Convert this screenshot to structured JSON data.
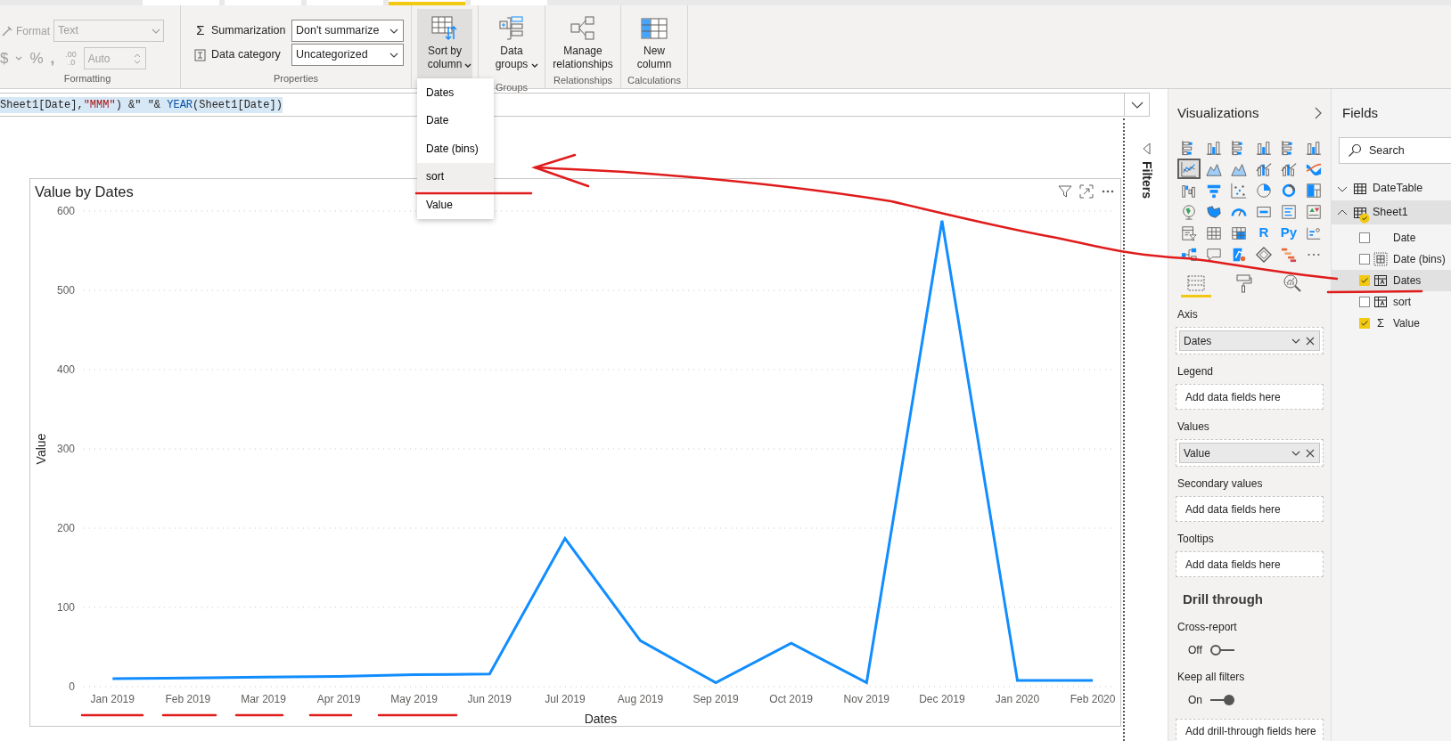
{
  "ribbon_tabs": [
    {
      "selected": false
    },
    {
      "selected": false
    },
    {
      "selected": false
    },
    {
      "selected": true
    },
    {
      "selected": false
    }
  ],
  "formatting": {
    "disabled": true,
    "format_label": "Format",
    "format_value": "Text",
    "currency": "$",
    "percent": "%",
    "comma": ",",
    "decimals_top": ".00",
    "decimals_bottom": ".0",
    "spin_value": "Auto",
    "label": "Formatting"
  },
  "properties": {
    "summarization": {
      "symbol": "Σ",
      "label": "Summarization",
      "value": "Don't summarize"
    },
    "data_category": {
      "label": "Data category",
      "value": "Uncategorized"
    },
    "label": "Properties"
  },
  "ribbon_buttons": [
    {
      "kind": "sort",
      "label": "Sort by column",
      "caret": true,
      "pressed": true
    },
    {
      "kind": "groups",
      "label": "Data groups",
      "caret": true,
      "pressed": false,
      "group": "Groups"
    },
    {
      "kind": "relationships",
      "label": "Manage relationships",
      "caret": false,
      "pressed": false,
      "group": "Relationships"
    },
    {
      "kind": "column",
      "label": "New column",
      "caret": false,
      "pressed": false,
      "group": "Calculations"
    }
  ],
  "sort_menu": [
    {
      "label": "Dates",
      "highlighted": false
    },
    {
      "label": "Date",
      "highlighted": false
    },
    {
      "label": "Date (bins)",
      "highlighted": false
    },
    {
      "label": "sort",
      "highlighted": true
    },
    {
      "label": "Value",
      "highlighted": false
    }
  ],
  "formula": [
    {
      "text": "Sheet1[Date],",
      "kind": "plain"
    },
    {
      "text": "\"MMM\"",
      "kind": "string"
    },
    {
      "text": ") &\" \"& ",
      "kind": "plain"
    },
    {
      "text": "YEAR",
      "kind": "function"
    },
    {
      "text": "(Sheet1[Date])",
      "kind": "plain"
    }
  ],
  "visual": {
    "chart_data": {
      "type": "line",
      "title": "Value by Dates",
      "xlabel": "Dates",
      "ylabel": "Value",
      "categories": [
        "Jan 2019",
        "Feb 2019",
        "Mar 2019",
        "Apr 2019",
        "May 2019",
        "Jun 2019",
        "Jul 2019",
        "Aug 2019",
        "Sep 2019",
        "Oct 2019",
        "Nov 2019",
        "Dec 2019",
        "Jan 2020",
        "Feb 2020"
      ],
      "values": [
        10,
        11,
        12,
        13,
        15,
        16,
        187,
        58,
        5,
        55,
        5,
        588,
        8,
        8
      ],
      "grid": true,
      "ylim": [
        0,
        600
      ],
      "yticks": [
        0,
        100,
        200,
        300,
        400,
        500,
        600
      ]
    }
  },
  "filters_pane": {
    "title": "Filters"
  },
  "visualizations": {
    "title": "Visualizations",
    "gallery": [
      {
        "kind": "hbar",
        "selected": false
      },
      {
        "kind": "col",
        "selected": false
      },
      {
        "kind": "hbar",
        "selected": false
      },
      {
        "kind": "col",
        "selected": false
      },
      {
        "kind": "hbar",
        "selected": false
      },
      {
        "kind": "col",
        "selected": false
      },
      {
        "kind": "line",
        "selected": true
      },
      {
        "kind": "area",
        "selected": false
      },
      {
        "kind": "area",
        "selected": false
      },
      {
        "kind": "combo",
        "selected": false
      },
      {
        "kind": "combo",
        "selected": false
      },
      {
        "kind": "ribbon",
        "selected": false
      },
      {
        "kind": "waterfall",
        "selected": false
      },
      {
        "kind": "funnel",
        "selected": false
      },
      {
        "kind": "scatter",
        "selected": false
      },
      {
        "kind": "pie",
        "selected": false
      },
      {
        "kind": "donut",
        "selected": false
      },
      {
        "kind": "treemap",
        "selected": false
      },
      {
        "kind": "globe",
        "selected": false
      },
      {
        "kind": "map",
        "selected": false
      },
      {
        "kind": "gauge",
        "selected": false
      },
      {
        "kind": "card",
        "selected": false
      },
      {
        "kind": "multirow",
        "selected": false
      },
      {
        "kind": "kpi",
        "selected": false
      },
      {
        "kind": "slicer",
        "selected": false
      },
      {
        "kind": "table",
        "selected": false
      },
      {
        "kind": "matrix",
        "selected": false
      },
      {
        "kind": "text",
        "text": "R",
        "selected": false
      },
      {
        "kind": "text",
        "text": "Py",
        "selected": false
      },
      {
        "kind": "influencers",
        "selected": false
      },
      {
        "kind": "decomposition",
        "selected": false
      },
      {
        "kind": "qa",
        "selected": false
      },
      {
        "kind": "pin",
        "selected": false
      },
      {
        "kind": "diamond",
        "selected": false
      },
      {
        "kind": "gantt",
        "selected": false
      },
      {
        "kind": "more",
        "selected": false
      }
    ],
    "pane_tabs": [
      {
        "kind": "fields",
        "selected": true
      },
      {
        "kind": "format",
        "selected": false
      },
      {
        "kind": "analytics",
        "selected": false
      }
    ],
    "wells": [
      {
        "label": "Axis",
        "field": "Dates"
      },
      {
        "label": "Legend",
        "placeholder": "Add data fields here"
      },
      {
        "label": "Values",
        "field": "Value"
      },
      {
        "label": "Secondary values",
        "placeholder": "Add data fields here"
      },
      {
        "label": "Tooltips",
        "placeholder": "Add data fields here"
      }
    ],
    "drill_through": {
      "title": "Drill through",
      "toggles": [
        {
          "label": "Cross-report",
          "state": "Off",
          "on": false
        },
        {
          "label": "Keep all filters",
          "state": "On",
          "on": true
        }
      ],
      "placeholder": "Add drill-through fields here"
    }
  },
  "fields": {
    "title": "Fields",
    "search": {
      "placeholder": "Search"
    },
    "tables": [
      {
        "name": "DateTable",
        "expanded": false,
        "selected": false,
        "has_checked": false
      },
      {
        "name": "Sheet1",
        "expanded": true,
        "selected": true,
        "has_checked": true,
        "children": [
          {
            "name": "Date",
            "kind": "plain",
            "checked": false,
            "selected": false
          },
          {
            "name": "Date (bins)",
            "kind": "bins",
            "checked": false,
            "selected": false
          },
          {
            "name": "Dates",
            "kind": "calculated",
            "checked": true,
            "selected": true
          },
          {
            "name": "sort",
            "kind": "calculated",
            "checked": false,
            "selected": false
          },
          {
            "name": "Value",
            "kind": "sum",
            "symbol": "Σ",
            "checked": true,
            "selected": false
          }
        ]
      }
    ]
  }
}
